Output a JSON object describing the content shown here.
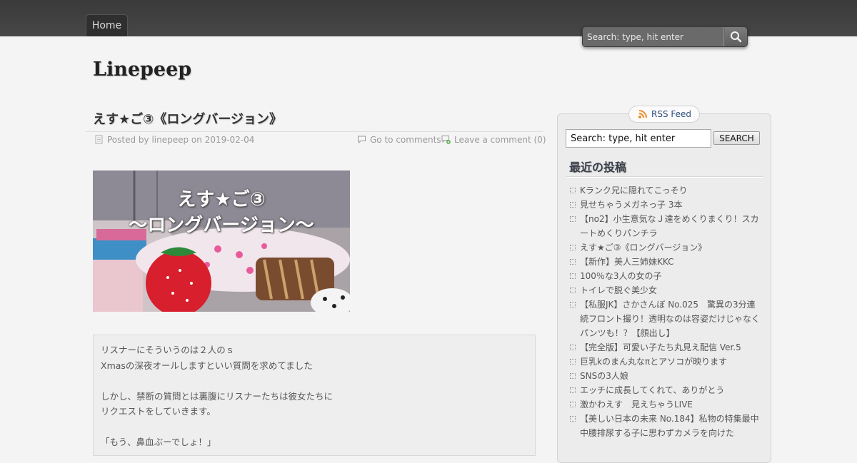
{
  "nav": {
    "home_label": "Home"
  },
  "header_search": {
    "placeholder": "Search: type, hit enter"
  },
  "site": {
    "title": "Linepeep"
  },
  "post": {
    "title": "えす★ご③《ロングバージョン》",
    "posted_by_text": "Posted by linepeep on 2019-02-04",
    "go_to_comments": "Go to comments",
    "leave_comment": "Leave a comment (0)",
    "thumbnail_caption_line1": "えす★ご③",
    "thumbnail_caption_line2": "〜ロングバージョン〜",
    "excerpt": [
      "リスナーにそういうのは２人のｓ",
      "Xmasの深夜オールしますといい質問を求めてました",
      "",
      "しかし、禁断の質問とは裏腹にリスナーたちは彼女たちに",
      "リクエストをしていきます。",
      "",
      "「もう、鼻血ぶーでしょ！」"
    ]
  },
  "sidebar": {
    "rss_label": "RSS Feed",
    "search_placeholder": "Search: type, hit enter",
    "search_button": "SEARCH",
    "recent_title": "最近の投稿",
    "recent_posts": [
      "Kランク兄に隠れてこっそり",
      "見せちゃうメガネっ子 3本",
      "【no2】小生意気なＪ達をめくりまくり！スカートめくりパンチラ",
      "えす★ご③《ロングバージョン》",
      "【新作】美人三姉妹KKC",
      "100％な3人の女の子",
      "トイレで脱ぐ美少女",
      "【私服JK】さかさんぼ No.025　驚異の3分連続フロント撮り！透明なのは容姿だけじゃなくパンツも！？【顔出し】",
      "【完全版】可愛い子たち丸見え配信 Ver.5",
      "巨乳kのまん丸なπとアソコが映ります",
      "SNSの3人娘",
      "エッチに成長してくれて、ありがとう",
      "激かわえす　見えちゃうLIVE",
      "【美しい日本の未来 No.184】私物の特集最中　中腰排尿する子に思わずカメラを向けた"
    ]
  },
  "colors": {
    "topbar": "#3f3f3f",
    "page_bg": "#f4f4f4",
    "link_blue": "#2f4f7a",
    "rss_orange": "#f08c2a"
  }
}
